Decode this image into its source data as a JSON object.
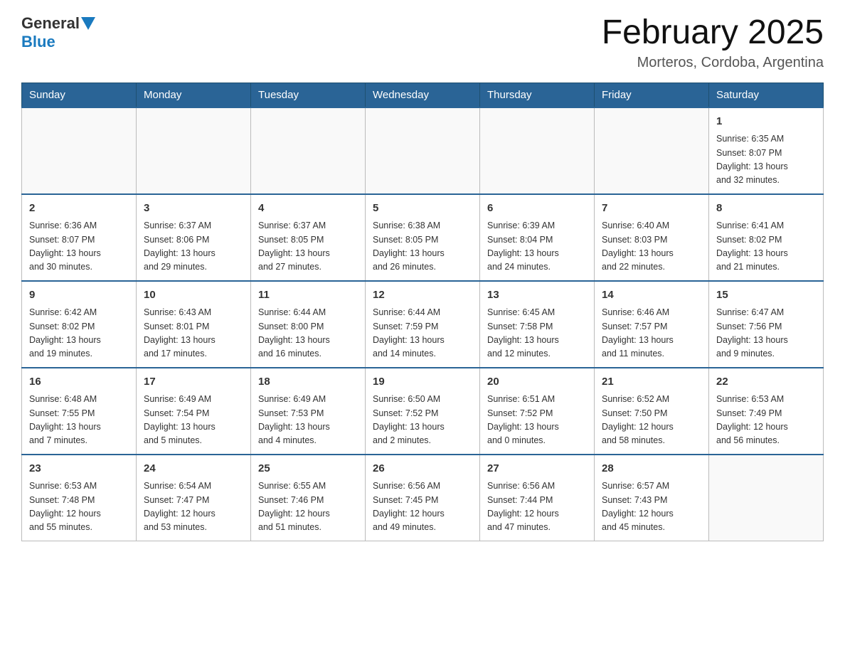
{
  "header": {
    "logo_general": "General",
    "logo_blue": "Blue",
    "month_title": "February 2025",
    "location": "Morteros, Cordoba, Argentina"
  },
  "days_of_week": [
    "Sunday",
    "Monday",
    "Tuesday",
    "Wednesday",
    "Thursday",
    "Friday",
    "Saturday"
  ],
  "weeks": [
    [
      {
        "day": "",
        "info": ""
      },
      {
        "day": "",
        "info": ""
      },
      {
        "day": "",
        "info": ""
      },
      {
        "day": "",
        "info": ""
      },
      {
        "day": "",
        "info": ""
      },
      {
        "day": "",
        "info": ""
      },
      {
        "day": "1",
        "info": "Sunrise: 6:35 AM\nSunset: 8:07 PM\nDaylight: 13 hours\nand 32 minutes."
      }
    ],
    [
      {
        "day": "2",
        "info": "Sunrise: 6:36 AM\nSunset: 8:07 PM\nDaylight: 13 hours\nand 30 minutes."
      },
      {
        "day": "3",
        "info": "Sunrise: 6:37 AM\nSunset: 8:06 PM\nDaylight: 13 hours\nand 29 minutes."
      },
      {
        "day": "4",
        "info": "Sunrise: 6:37 AM\nSunset: 8:05 PM\nDaylight: 13 hours\nand 27 minutes."
      },
      {
        "day": "5",
        "info": "Sunrise: 6:38 AM\nSunset: 8:05 PM\nDaylight: 13 hours\nand 26 minutes."
      },
      {
        "day": "6",
        "info": "Sunrise: 6:39 AM\nSunset: 8:04 PM\nDaylight: 13 hours\nand 24 minutes."
      },
      {
        "day": "7",
        "info": "Sunrise: 6:40 AM\nSunset: 8:03 PM\nDaylight: 13 hours\nand 22 minutes."
      },
      {
        "day": "8",
        "info": "Sunrise: 6:41 AM\nSunset: 8:02 PM\nDaylight: 13 hours\nand 21 minutes."
      }
    ],
    [
      {
        "day": "9",
        "info": "Sunrise: 6:42 AM\nSunset: 8:02 PM\nDaylight: 13 hours\nand 19 minutes."
      },
      {
        "day": "10",
        "info": "Sunrise: 6:43 AM\nSunset: 8:01 PM\nDaylight: 13 hours\nand 17 minutes."
      },
      {
        "day": "11",
        "info": "Sunrise: 6:44 AM\nSunset: 8:00 PM\nDaylight: 13 hours\nand 16 minutes."
      },
      {
        "day": "12",
        "info": "Sunrise: 6:44 AM\nSunset: 7:59 PM\nDaylight: 13 hours\nand 14 minutes."
      },
      {
        "day": "13",
        "info": "Sunrise: 6:45 AM\nSunset: 7:58 PM\nDaylight: 13 hours\nand 12 minutes."
      },
      {
        "day": "14",
        "info": "Sunrise: 6:46 AM\nSunset: 7:57 PM\nDaylight: 13 hours\nand 11 minutes."
      },
      {
        "day": "15",
        "info": "Sunrise: 6:47 AM\nSunset: 7:56 PM\nDaylight: 13 hours\nand 9 minutes."
      }
    ],
    [
      {
        "day": "16",
        "info": "Sunrise: 6:48 AM\nSunset: 7:55 PM\nDaylight: 13 hours\nand 7 minutes."
      },
      {
        "day": "17",
        "info": "Sunrise: 6:49 AM\nSunset: 7:54 PM\nDaylight: 13 hours\nand 5 minutes."
      },
      {
        "day": "18",
        "info": "Sunrise: 6:49 AM\nSunset: 7:53 PM\nDaylight: 13 hours\nand 4 minutes."
      },
      {
        "day": "19",
        "info": "Sunrise: 6:50 AM\nSunset: 7:52 PM\nDaylight: 13 hours\nand 2 minutes."
      },
      {
        "day": "20",
        "info": "Sunrise: 6:51 AM\nSunset: 7:52 PM\nDaylight: 13 hours\nand 0 minutes."
      },
      {
        "day": "21",
        "info": "Sunrise: 6:52 AM\nSunset: 7:50 PM\nDaylight: 12 hours\nand 58 minutes."
      },
      {
        "day": "22",
        "info": "Sunrise: 6:53 AM\nSunset: 7:49 PM\nDaylight: 12 hours\nand 56 minutes."
      }
    ],
    [
      {
        "day": "23",
        "info": "Sunrise: 6:53 AM\nSunset: 7:48 PM\nDaylight: 12 hours\nand 55 minutes."
      },
      {
        "day": "24",
        "info": "Sunrise: 6:54 AM\nSunset: 7:47 PM\nDaylight: 12 hours\nand 53 minutes."
      },
      {
        "day": "25",
        "info": "Sunrise: 6:55 AM\nSunset: 7:46 PM\nDaylight: 12 hours\nand 51 minutes."
      },
      {
        "day": "26",
        "info": "Sunrise: 6:56 AM\nSunset: 7:45 PM\nDaylight: 12 hours\nand 49 minutes."
      },
      {
        "day": "27",
        "info": "Sunrise: 6:56 AM\nSunset: 7:44 PM\nDaylight: 12 hours\nand 47 minutes."
      },
      {
        "day": "28",
        "info": "Sunrise: 6:57 AM\nSunset: 7:43 PM\nDaylight: 12 hours\nand 45 minutes."
      },
      {
        "day": "",
        "info": ""
      }
    ]
  ]
}
